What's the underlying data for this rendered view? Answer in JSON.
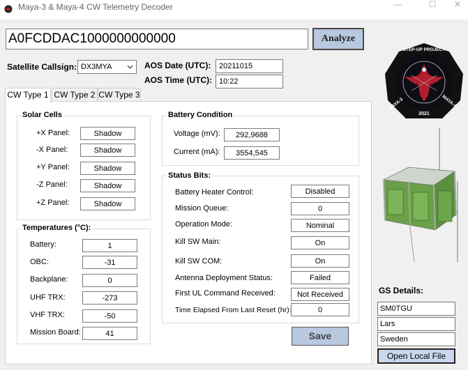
{
  "window": {
    "title": "Maya-3 & Maya-4 CW Telemetry Decoder",
    "minimize": "—",
    "maximize": "☐",
    "close": "✕"
  },
  "main": {
    "hex_value": "A0FCDDAC1000000000000",
    "analyze_label": "Analyze"
  },
  "header": {
    "callsign_label": "Satellite Callsign:",
    "callsign_value": "DX3MYA",
    "aos_date_label": "AOS Date (UTC):",
    "aos_date_value": "20211015",
    "aos_time_label": "AOS Time (UTC):",
    "aos_time_value": "10:22"
  },
  "tabs": [
    {
      "label": "CW Type 1"
    },
    {
      "label": "CW Type 2"
    },
    {
      "label": "CW Type 3"
    }
  ],
  "solar": {
    "title": "Solar Cells",
    "rows": [
      {
        "label": "+X Panel:",
        "value": "Shadow"
      },
      {
        "label": "-X Panel:",
        "value": "Shadow"
      },
      {
        "label": "+Y Panel:",
        "value": "Shadow"
      },
      {
        "label": "-Z Panel:",
        "value": "Shadow"
      },
      {
        "label": "+Z Panel:",
        "value": "Shadow"
      }
    ]
  },
  "temps": {
    "title": "Temperatures (°C):",
    "rows": [
      {
        "label": "Battery:",
        "value": "1"
      },
      {
        "label": "OBC:",
        "value": "-31"
      },
      {
        "label": "Backplane:",
        "value": "0"
      },
      {
        "label": "UHF TRX:",
        "value": "-273"
      },
      {
        "label": "VHF TRX:",
        "value": "-50"
      },
      {
        "label": "Mission Board:",
        "value": "41"
      }
    ]
  },
  "battery": {
    "title": "Battery Condition",
    "voltage_label": "Voltage (mV):",
    "voltage_value": "292,9688",
    "current_label": "Current (mA):",
    "current_value": "3554,545"
  },
  "status": {
    "title": "Status Bits:",
    "rows": [
      {
        "label": "Battery Heater Control:",
        "value": "Disabled"
      },
      {
        "label": "Mission Queue:",
        "value": "0"
      },
      {
        "label": "Operation Mode:",
        "value": "Nominal"
      },
      {
        "label": "Kill SW Main:",
        "value": "On"
      },
      {
        "label": "Kill SW COM:",
        "value": "On"
      },
      {
        "label": "Antenna Deployment Status:",
        "value": "Failed"
      },
      {
        "label": "First UL Command Received:",
        "value": "Not Received"
      },
      {
        "label": "Time Elapsed From Last Reset (hr):",
        "value": "0"
      }
    ]
  },
  "save_label": "Save",
  "logo": {
    "top_text": "STEP-UP PROJECT",
    "left_text": "MAYA-3",
    "right_text": "MAYA-4",
    "year": "2021"
  },
  "gs": {
    "title": "GS Details:",
    "callsign": "SM0TGU",
    "name": "Lars",
    "country": "Sweden",
    "open_label": "Open Local File"
  }
}
